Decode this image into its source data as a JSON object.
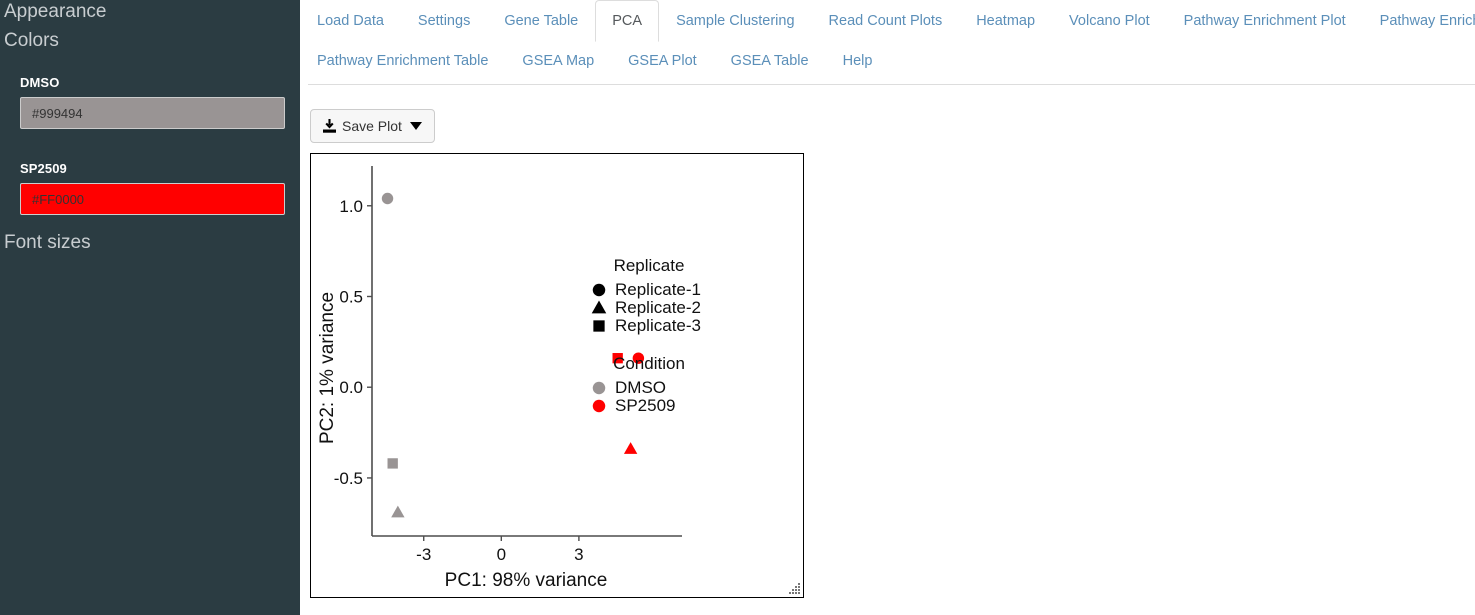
{
  "sidebar": {
    "appearance_title": "Appearance",
    "colors_title": "Colors",
    "font_sizes_title": "Font sizes",
    "color_inputs": [
      {
        "label": "DMSO",
        "value": "#999494",
        "swatch": "#999494"
      },
      {
        "label": "SP2509",
        "value": "#FF0000",
        "swatch": "#FF0000"
      }
    ]
  },
  "tabs": {
    "row1": [
      {
        "label": "Load Data",
        "active": false
      },
      {
        "label": "Settings",
        "active": false
      },
      {
        "label": "Gene Table",
        "active": false
      },
      {
        "label": "PCA",
        "active": true
      },
      {
        "label": "Sample Clustering",
        "active": false
      },
      {
        "label": "Read Count Plots",
        "active": false
      },
      {
        "label": "Heatmap",
        "active": false
      },
      {
        "label": "Volcano Plot",
        "active": false
      },
      {
        "label": "Pathway Enrichment Plot",
        "active": false
      },
      {
        "label": "Pathway Enrichment Map",
        "active": false
      }
    ],
    "row2": [
      {
        "label": "Pathway Enrichment Table",
        "active": false
      },
      {
        "label": "GSEA Map",
        "active": false
      },
      {
        "label": "GSEA Plot",
        "active": false
      },
      {
        "label": "GSEA Table",
        "active": false
      },
      {
        "label": "Help",
        "active": false
      }
    ]
  },
  "toolbar": {
    "save_plot_label": "Save Plot",
    "download_icon": "download-icon",
    "caret_icon": "caret-down-icon"
  },
  "chart_data": {
    "type": "scatter",
    "title": "",
    "xlabel": "PC1: 98% variance",
    "ylabel": "PC2: 1% variance",
    "xticks": [
      -3,
      0,
      3
    ],
    "xticklabels": [
      "-3",
      "0",
      "3"
    ],
    "yticks": [
      1.0,
      0.5,
      0.0,
      -0.5
    ],
    "yticklabels": [
      "1.0",
      "0.5",
      "0.0",
      "-0.5"
    ],
    "xlim": [
      -5.0,
      6.6
    ],
    "ylim": [
      -0.82,
      1.12
    ],
    "grid": false,
    "colors": {
      "DMSO": "#999494",
      "SP2509": "#FF0000"
    },
    "points": [
      {
        "x": -4.4,
        "y": 1.04,
        "condition": "DMSO",
        "replicate": "Replicate-1",
        "shape": "circle"
      },
      {
        "x": -4.2,
        "y": -0.42,
        "condition": "DMSO",
        "replicate": "Replicate-3",
        "shape": "square"
      },
      {
        "x": -4.0,
        "y": -0.69,
        "condition": "DMSO",
        "replicate": "Replicate-2",
        "shape": "triangle"
      },
      {
        "x": 4.5,
        "y": 0.16,
        "condition": "SP2509",
        "replicate": "Replicate-3",
        "shape": "square"
      },
      {
        "x": 5.3,
        "y": 0.16,
        "condition": "SP2509",
        "replicate": "Replicate-1",
        "shape": "circle"
      },
      {
        "x": 5.0,
        "y": -0.34,
        "condition": "SP2509",
        "replicate": "Replicate-2",
        "shape": "triangle"
      }
    ],
    "legends": [
      {
        "title": "Replicate",
        "entries": [
          {
            "label": "Replicate-1",
            "shape": "circle",
            "color": "#000000"
          },
          {
            "label": "Replicate-2",
            "shape": "triangle",
            "color": "#000000"
          },
          {
            "label": "Replicate-3",
            "shape": "square",
            "color": "#000000"
          }
        ]
      },
      {
        "title": "Condition",
        "entries": [
          {
            "label": "DMSO",
            "shape": "circle",
            "color": "#999494"
          },
          {
            "label": "SP2509",
            "shape": "circle",
            "color": "#FF0000"
          }
        ]
      }
    ],
    "legend_position": "inside-right"
  }
}
